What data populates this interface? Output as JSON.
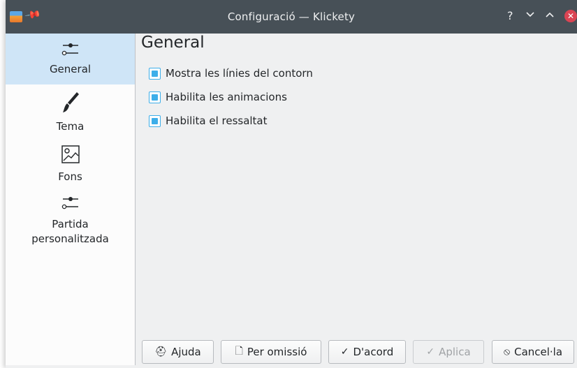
{
  "window": {
    "title": "Configuració — Klickety"
  },
  "titlebar_buttons": {
    "help": "?",
    "minimize": "⌵",
    "maximize": "⌃",
    "close": "✕"
  },
  "sidebar": {
    "items": [
      {
        "label": "General",
        "icon": "sliders-icon",
        "selected": true
      },
      {
        "label": "Tema",
        "icon": "paintbrush-icon",
        "selected": false
      },
      {
        "label": "Fons",
        "icon": "image-icon",
        "selected": false
      },
      {
        "label_line1": "Partida",
        "label_line2": "personalitzada",
        "icon": "sliders-icon",
        "selected": false
      }
    ]
  },
  "main": {
    "heading": "General",
    "options": [
      {
        "label": "Mostra les línies del contorn",
        "checked": true
      },
      {
        "label": "Habilita les animacions",
        "checked": true
      },
      {
        "label": "Habilita el ressaltat",
        "checked": true
      }
    ]
  },
  "buttons": {
    "help": "Ajuda",
    "defaults": "Per omissió",
    "ok": "D'acord",
    "apply": "Aplica",
    "cancel": "Cancel·la"
  },
  "colors": {
    "titlebar": "#475057",
    "accent": "#3daee9",
    "selection": "#cfe5f7",
    "close": "#da4453"
  }
}
